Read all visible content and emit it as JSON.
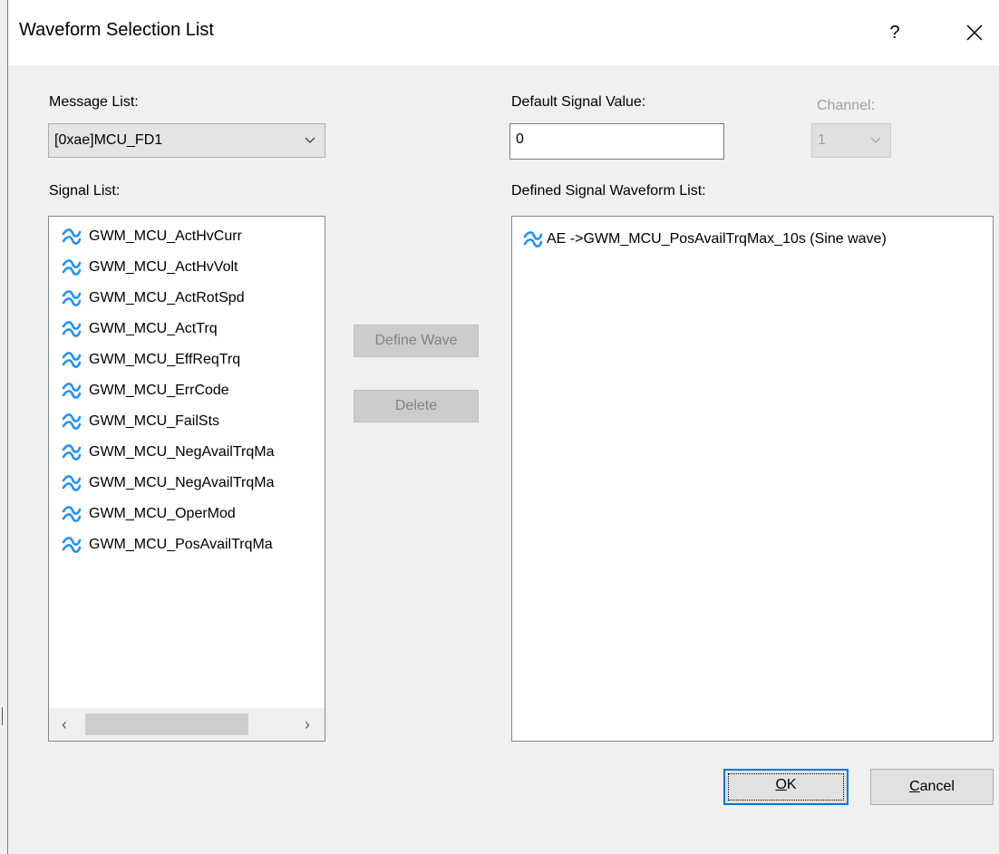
{
  "dialog": {
    "title": "Waveform Selection List",
    "help": "?"
  },
  "message_list": {
    "label": "Message List:",
    "selected": "[0xae]MCU_FD1"
  },
  "default_signal": {
    "label": "Default Signal Value:",
    "value": "0"
  },
  "channel": {
    "label": "Channel:",
    "selected": "1"
  },
  "signal_list": {
    "label": "Signal List:",
    "items": [
      "GWM_MCU_ActHvCurr",
      "GWM_MCU_ActHvVolt",
      "GWM_MCU_ActRotSpd",
      "GWM_MCU_ActTrq",
      "GWM_MCU_EffReqTrq",
      "GWM_MCU_ErrCode",
      "GWM_MCU_FailSts",
      "GWM_MCU_NegAvailTrqMa",
      "GWM_MCU_NegAvailTrqMa",
      "GWM_MCU_OperMod",
      "GWM_MCU_PosAvailTrqMa"
    ]
  },
  "defined_list": {
    "label": "Defined Signal Waveform List:",
    "items": [
      "AE ->GWM_MCU_PosAvailTrqMax_10s (Sine wave)"
    ]
  },
  "buttons": {
    "define_wave": "Define Wave",
    "delete": "Delete",
    "ok_mnemonic": "O",
    "ok_rest": "K",
    "cancel_mnemonic": "C",
    "cancel_rest": "ancel"
  },
  "colors": {
    "wave_icon": "#1e90ff",
    "default_button_border": "#0078d7"
  }
}
